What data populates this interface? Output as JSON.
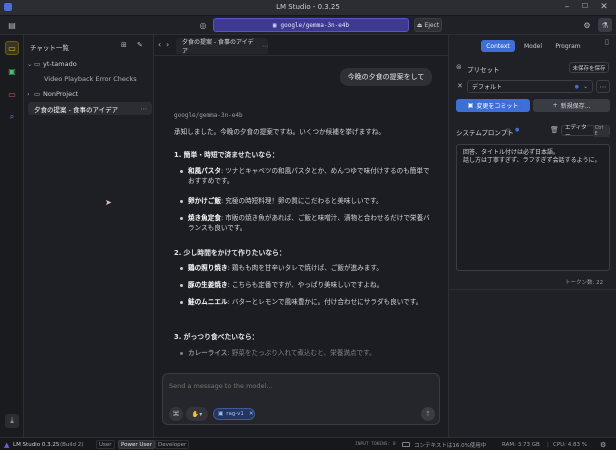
{
  "window": {
    "title": "LM Studio - 0.3.25"
  },
  "topbar": {
    "model_name": "google/gemma-3n-e4b",
    "eject_label": "Eject"
  },
  "chatlist": {
    "header": "チャット一覧",
    "items": [
      {
        "label": "yt-tamado",
        "type": "folder-open"
      },
      {
        "label": "Video Playback Error Checks",
        "type": "chat"
      },
      {
        "label": "NonProject",
        "type": "folder"
      },
      {
        "label": "夕食の提案 - 食事のアイデア",
        "type": "chat-active"
      }
    ]
  },
  "tab": {
    "label": "夕食の提案 - 食事のアイデア"
  },
  "chat": {
    "user_message": "今晩の夕食の提案をして",
    "model_label": "google/gemma-3n-e4b",
    "intro": "承知しました。今晩の夕食の提案ですね。いくつか候補を挙げますね。",
    "sections": [
      {
        "heading": "1. 簡単・時短で済ませたいなら：",
        "items": [
          {
            "bold": "和風パスタ",
            "text": ": ツナとキャベツの和風パスタとか、めんつゆで味付けするのも簡単でおすすめです。"
          },
          {
            "bold": "卵かけご飯",
            "text": ": 究極の時短料理！卵の質にこだわると美味しいです。"
          },
          {
            "bold": "焼き魚定食",
            "text": ": 市販の焼き魚があれば、ご飯と味噌汁、漬物と合わせるだけで栄養バランスも良いです。"
          }
        ]
      },
      {
        "heading": "2. 少し時間をかけて作りたいなら：",
        "items": [
          {
            "bold": "鶏の照り焼き",
            "text": ": 鶏もも肉を甘辛いタレで焼けば、ご飯が進みます。"
          },
          {
            "bold": "豚の生姜焼き",
            "text": ": こちらも定番ですが、やっぱり美味しいですよね。"
          },
          {
            "bold": "鮭のムニエル",
            "text": ": バターとレモンで風味豊かに。付け合わせにサラダも良いです。"
          }
        ]
      },
      {
        "heading": "3. がっつり食べたいなら：",
        "items": [
          {
            "bold": "カレーライス",
            "text": ": 野菜をたっぷり入れて煮込むと、栄養満点です。"
          }
        ]
      }
    ]
  },
  "composer": {
    "placeholder": "Send a message to the model...",
    "tag_label": "rag-v1"
  },
  "right": {
    "tabs": [
      "Context",
      "Model",
      "Program"
    ],
    "preset_label": "プリセット",
    "save_unsaved": "未保存を保存",
    "preset_value": "デフォルト",
    "commit_label": "変更をコミット",
    "save_new_label": "新規保存...",
    "system_prompt_label": "システムプロンプト",
    "editor_label": "エディター",
    "editor_shortcut": "Ctrl E",
    "system_prompt_text": "回答、タイトル付けは必ず日本語。\n話し方は丁寧すぎず、ラフすぎず会話するように。",
    "token_count": "トークン数: 22"
  },
  "statusbar": {
    "app": "LM Studio 0.3.25",
    "build": "(Build 2)",
    "modes": [
      "User",
      "Power User",
      "Developer"
    ],
    "input_tokens": "INPUT TOKENS: 0",
    "context": "コンテキストは16.0%使用中",
    "ram": "RAM: 3.73 GB",
    "cpu": "CPU: 4.83 %"
  },
  "colors": {
    "accent": "#3d6fd6",
    "model_pill": "#3d3a8f",
    "rail_active": "#e0b83a"
  }
}
